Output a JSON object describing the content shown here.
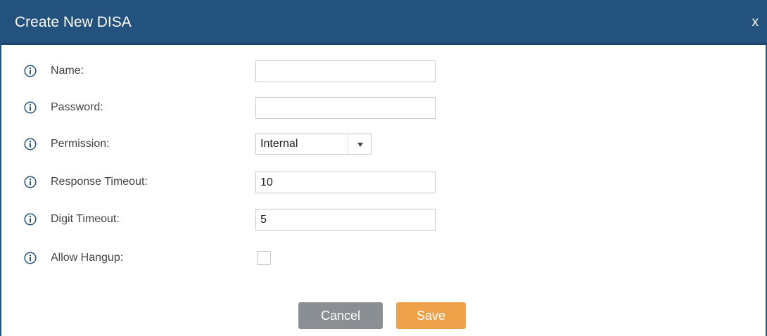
{
  "dialog": {
    "title": "Create New DISA",
    "close_label": "x"
  },
  "fields": {
    "name": {
      "label": "Name:",
      "value": ""
    },
    "password": {
      "label": "Password:",
      "value": ""
    },
    "permission": {
      "label": "Permission:",
      "selected": "Internal"
    },
    "response_timeout": {
      "label": "Response Timeout:",
      "value": "10"
    },
    "digit_timeout": {
      "label": "Digit Timeout:",
      "value": "5"
    },
    "allow_hangup": {
      "label": "Allow Hangup:",
      "checked": false
    }
  },
  "buttons": {
    "cancel_label": "Cancel",
    "save_label": "Save"
  },
  "colors": {
    "titlebar": "#24527f",
    "save_button": "#f0a24a",
    "cancel_button": "#8a8f94",
    "info_icon": "#24527f"
  },
  "icons": {
    "info": "info-icon",
    "dropdown": "chevron-down-icon"
  }
}
